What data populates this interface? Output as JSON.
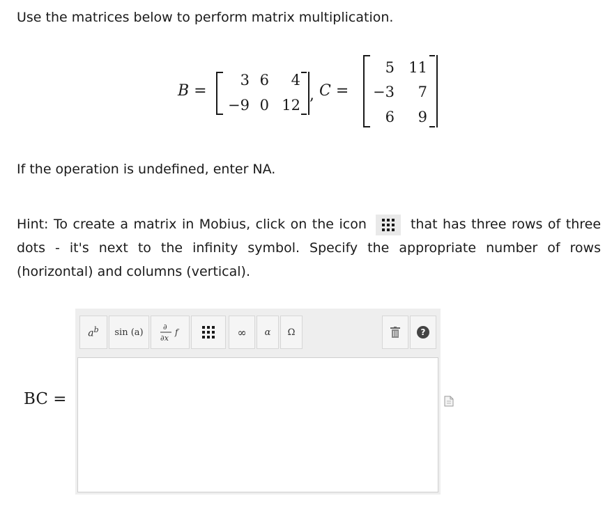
{
  "instruction": "Use the matrices below to perform matrix multiplication.",
  "matrices": {
    "b_label": "B",
    "b_rows": [
      [
        "3",
        "6",
        "4"
      ],
      [
        "−9",
        "0",
        "12"
      ]
    ],
    "c_label": "C",
    "c_rows": [
      [
        "5",
        "11"
      ],
      [
        "−3",
        "7"
      ],
      [
        "6",
        "9"
      ]
    ],
    "equals": "=",
    "comma": ","
  },
  "undefined_note": "If the operation is undefined, enter NA.",
  "hint": {
    "before_icon": "Hint: To create a matrix in Mobius, click on the icon",
    "after_icon": "that has three rows of three dots - it's next to the infinity symbol. Specify the appropriate number of rows (horizontal) and columns (vertical).",
    "icon": "matrix-grid-icon"
  },
  "answer": {
    "label": "BC =",
    "value": ""
  },
  "toolbar": {
    "superscript_icon": "superscript-icon",
    "function_label": "sin (a)",
    "derivative_icon": "partial-derivative-icon",
    "matrix_icon": "matrix-grid-icon",
    "infinity_symbol": "∞",
    "alpha_symbol": "α",
    "omega_symbol": "Ω",
    "trash_icon": "trash-icon",
    "help_symbol": "?"
  }
}
